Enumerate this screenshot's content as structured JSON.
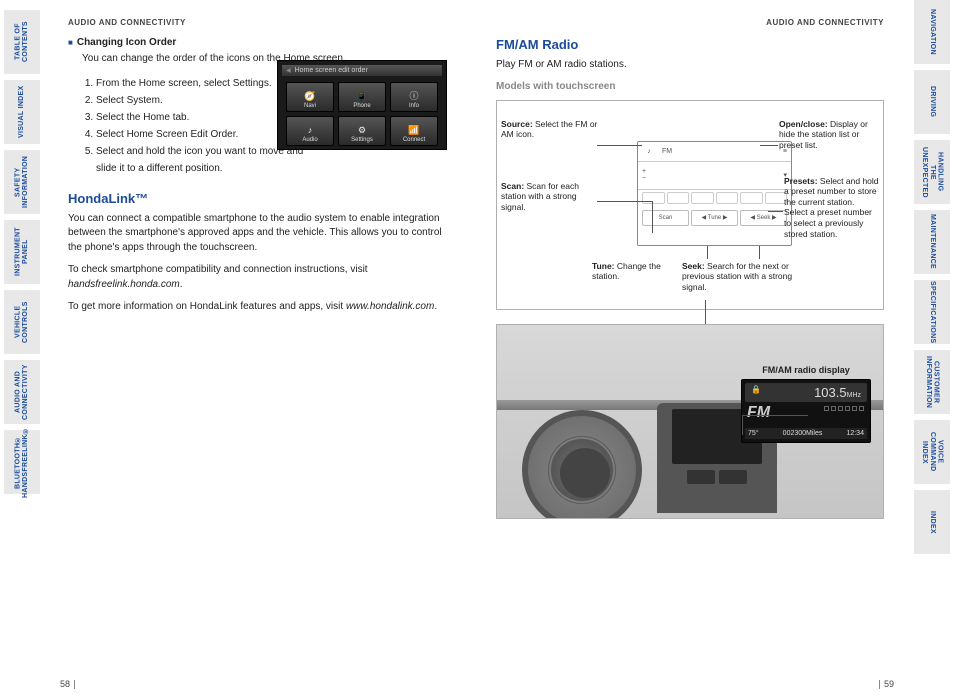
{
  "header": "AUDIO AND CONNECTIVITY",
  "left_tabs": [
    "TABLE OF CONTENTS",
    "VISUAL INDEX",
    "SAFETY INFORMATION",
    "INSTRUMENT PANEL",
    "VEHICLE CONTROLS",
    "AUDIO AND CONNECTIVITY",
    "BLUETOOTH® HANDSFREELINK®"
  ],
  "right_tabs": [
    "NAVIGATION",
    "DRIVING",
    "HANDLING THE UNEXPECTED",
    "MAINTENANCE",
    "SPECIFICATIONS",
    "CUSTOMER INFORMATION",
    "VOICE COMMAND INDEX",
    "INDEX"
  ],
  "left_page": {
    "section_title": "Changing Icon Order",
    "intro": "You can change the order of the icons on the Home screen.",
    "steps": [
      "From the Home screen, select Settings.",
      "Select System.",
      "Select the Home tab.",
      "Select Home Screen Edit Order.",
      "Select and hold the icon you want to move and slide it to a different position."
    ],
    "touchscreen": {
      "title": "Home screen edit order",
      "icons": [
        "Navi",
        "Phone",
        "Info",
        "Audio",
        "Settings",
        "Connect"
      ]
    },
    "hondalink_title": "HondaLink™",
    "para1": "You can connect a compatible smartphone to the audio system to enable integration between the smartphone's approved apps and the vehicle. This allows you to control the phone's apps through the touchscreen.",
    "para2a": "To check smartphone compatibility and connection instructions, visit ",
    "para2b": "handsfreelink.honda.com",
    "para2c": ".",
    "para3a": "To get more information on HondaLink features and apps, visit ",
    "para3b": "www.hondalink.com",
    "para3c": ".",
    "page_no": "58"
  },
  "right_page": {
    "title": "FM/AM Radio",
    "intro": "Play FM or AM radio stations.",
    "sub": "Models with touchscreen",
    "callouts": {
      "source": {
        "h": "Source:",
        "t": " Select the FM or AM icon."
      },
      "scan": {
        "h": "Scan:",
        "t": " Scan for each station with a strong signal."
      },
      "tune": {
        "h": "Tune:",
        "t": " Change the station."
      },
      "seek": {
        "h": "Seek:",
        "t": " Search for the next or previous station with a strong signal."
      },
      "open": {
        "h": "Open/close:",
        "t": " Display or hide the station list or preset list."
      },
      "presets": {
        "h": "Presets:",
        "t": " Select and hold a preset number to store the current station.\nSelect a preset number to select a previously stored station."
      }
    },
    "ts": {
      "fm": "FM",
      "btns": [
        "Scan",
        "Tune",
        "Seek"
      ],
      "arrows": "◀  ▶"
    },
    "dash": {
      "caption": "FM/AM radio display",
      "freq": "103.5",
      "unit": "MHz",
      "band": "FM",
      "temp": "75°",
      "odo": "002300Miles",
      "time": "12:34"
    },
    "page_no": "59"
  }
}
